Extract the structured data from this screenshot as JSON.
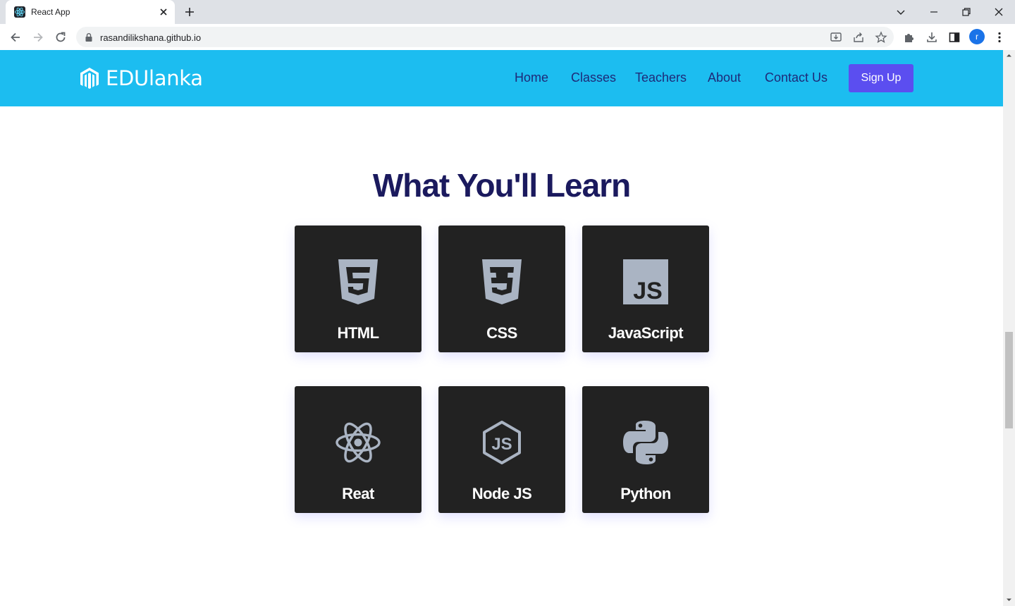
{
  "browser": {
    "tab_title": "React App",
    "url": "rasandilikshana.github.io",
    "profile_initial": "r"
  },
  "navbar": {
    "brand": "EDUlanka",
    "links": [
      "Home",
      "Classes",
      "Teachers",
      "About",
      "Contact Us"
    ],
    "signup_label": "Sign Up",
    "bg_color": "#1cbdf0",
    "link_color": "#1e2a78",
    "button_color": "#5b4ef0"
  },
  "section": {
    "heading": "What You'll Learn",
    "cards": [
      {
        "label": "HTML",
        "icon": "html5-icon"
      },
      {
        "label": "CSS",
        "icon": "css3-icon"
      },
      {
        "label": "JavaScript",
        "icon": "javascript-icon"
      },
      {
        "label": "Reat",
        "icon": "react-icon"
      },
      {
        "label": "Node JS",
        "icon": "nodejs-icon"
      },
      {
        "label": "Python",
        "icon": "python-icon"
      }
    ]
  }
}
